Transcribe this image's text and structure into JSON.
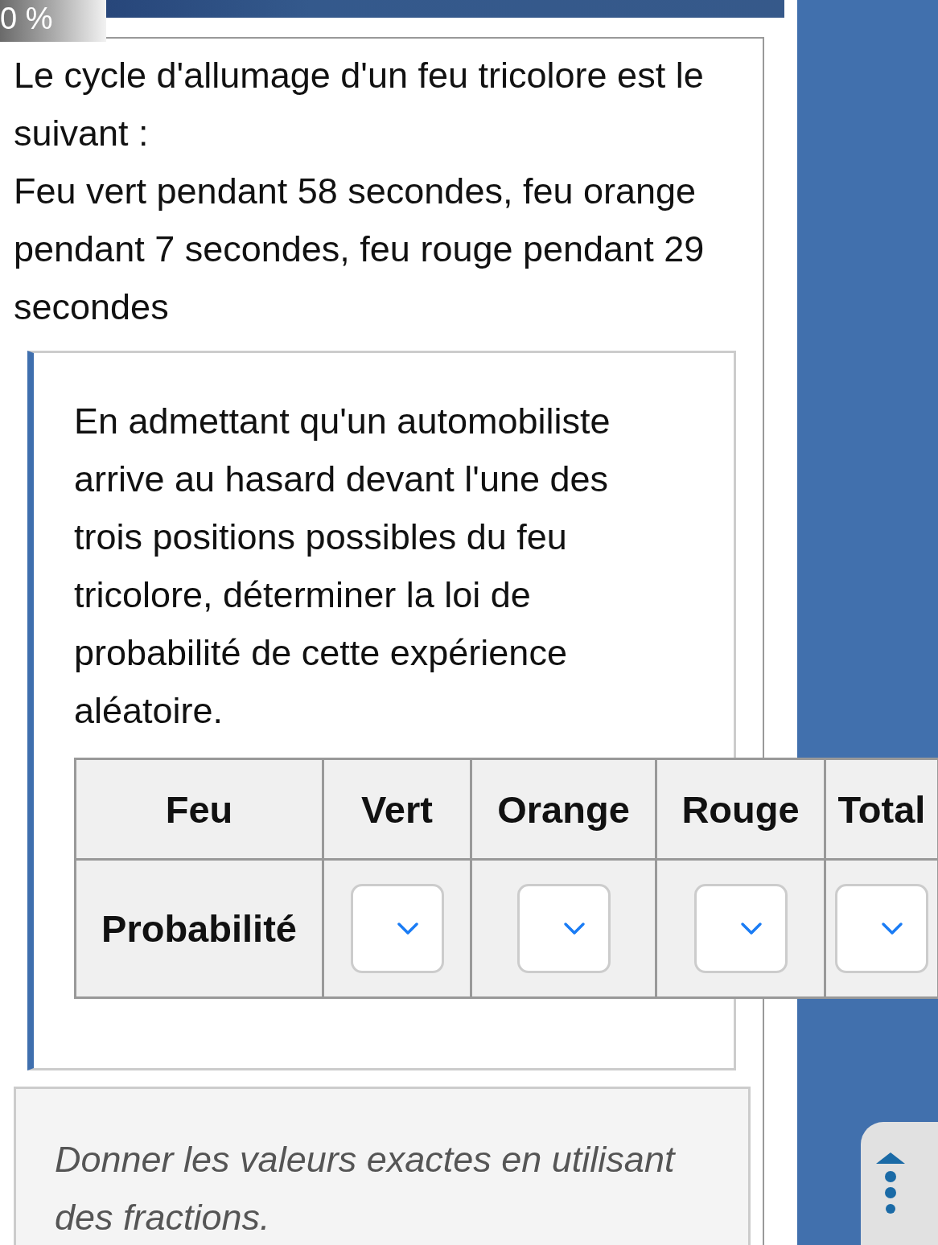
{
  "progress": {
    "label": "0 %",
    "level": 0
  },
  "intro": [
    "Le cycle d'allumage d'un feu tricolore est le suivant :",
    "Feu vert pendant 58 secondes, feu orange pendant 7 secondes, feu rouge pendant 29 secondes"
  ],
  "question": {
    "text": "En admettant qu'un automobiliste arrive au hasard devant l'une des trois positions possibles du feu tricolore, déterminer la loi de probabilité de cette expérience aléatoire.",
    "table": {
      "columns": [
        "Feu",
        "Vert",
        "Orange",
        "Rouge",
        "Total"
      ],
      "rows": [
        {
          "label": "Probabilité",
          "cells": [
            {
              "kind": "dropdown"
            },
            {
              "kind": "dropdown"
            },
            {
              "kind": "dropdown"
            },
            {
              "kind": "dropdown"
            }
          ]
        }
      ]
    }
  },
  "hint": "Donner les valeurs exactes en utilisant des fractions."
}
